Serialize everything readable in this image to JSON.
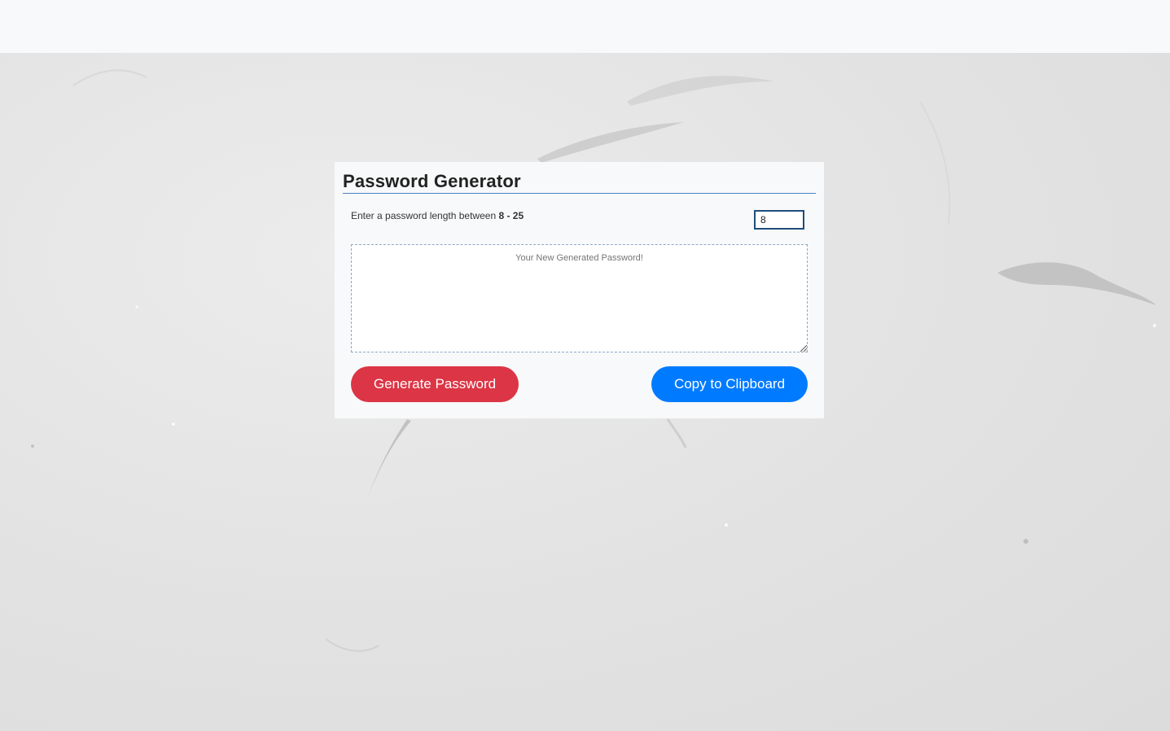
{
  "app": {
    "title": "Password Generator"
  },
  "form": {
    "length_label_prefix": "Enter a password length between ",
    "length_range": "8 - 25",
    "length_value": "8",
    "output_placeholder": "Your New Generated Password!",
    "output_value": ""
  },
  "buttons": {
    "generate_label": "Generate Password",
    "copy_label": "Copy to Clipboard"
  },
  "colors": {
    "generate_button": "#dc3545",
    "copy_button": "#007bff",
    "card_background": "#f8f9fa",
    "title_underline": "#4a7fc1"
  }
}
